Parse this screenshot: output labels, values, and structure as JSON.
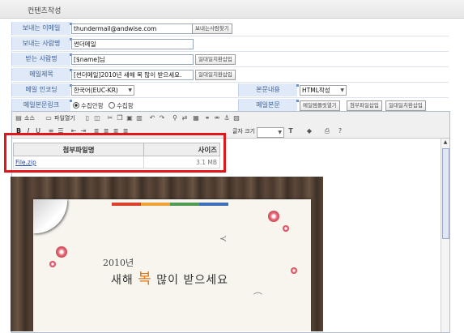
{
  "section_title": "컨텐츠작성",
  "form": {
    "sender_email": {
      "label": "보내는 이메일",
      "value": "thundermail@andwise.com",
      "button": "보내는사람찾기"
    },
    "sender_name": {
      "label": "보내는 사람명",
      "value": "썬더메일"
    },
    "recipient_name": {
      "label": "받는 사람명",
      "value": "[$name]님",
      "button": "일대일치환삽입"
    },
    "subject": {
      "label": "메일제목",
      "value": "[썬더메일]2010년 새해 복 많이 받으세요.",
      "button": "일대일치환삽입"
    },
    "encoding": {
      "label": "메일 인코딩",
      "value": "한국어(EUC-KR)"
    },
    "body_content": {
      "label": "본문내용",
      "value": "HTML작성"
    },
    "body_link": {
      "label": "메일본문링크",
      "option_off": "수집안함",
      "option_on": "수집함"
    },
    "mail_body": {
      "label": "메일본문",
      "template_button": "메일템플릿열기",
      "attach_button": "첨부파일삽입",
      "replace_button": "일대일치환삽입"
    }
  },
  "toolbar": {
    "source": "소스",
    "open_file": "파일열기",
    "font_size_label": "글자 크기"
  },
  "attachment": {
    "header_name": "첨부파일명",
    "header_size": "사이즈",
    "file_name": "File.zip",
    "file_size": "3.1 MB"
  },
  "card": {
    "year": "2010년",
    "greeting_before": "새해",
    "greeting_bok": "복",
    "greeting_after": "많이 받으세요"
  },
  "colors": {
    "highlight_border": "#e0161b",
    "label_bg": "#dfe9f8",
    "label_text": "#3b5f9a",
    "stripe_red": "#d9412a",
    "stripe_orange": "#f0a23a",
    "stripe_green": "#4f9b54",
    "stripe_blue": "#3f6fb8"
  }
}
